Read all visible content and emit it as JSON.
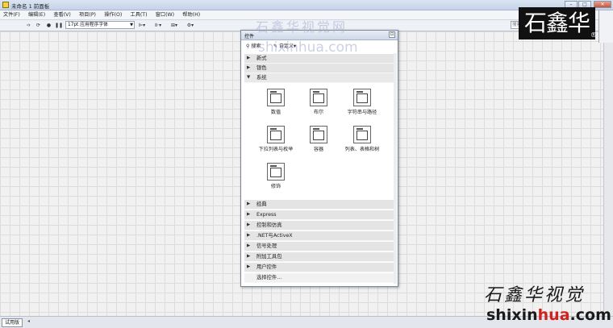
{
  "window": {
    "title": "未命名 1 前面板"
  },
  "menu": [
    "文件(F)",
    "编辑(E)",
    "查看(V)",
    "项目(P)",
    "操作(O)",
    "工具(T)",
    "窗口(W)",
    "帮助(H)"
  ],
  "toolbar": {
    "font": "17pt 应用程序字体",
    "search_placeholder": "搜索"
  },
  "palette": {
    "title": "控件",
    "search_label": "搜索",
    "customize_label": "自定义",
    "categories_top": [
      "新式",
      "银色",
      "系统"
    ],
    "items": [
      "数值",
      "布尔",
      "字符串与路径",
      "下拉列表与枚举",
      "容器",
      "列表、表格和树",
      "修饰"
    ],
    "categories_bottom": [
      "经典",
      "Express",
      "控制和仿真",
      ".NET与ActiveX",
      "信号处理",
      "附加工具包",
      "用户控件",
      "选择控件..."
    ]
  },
  "status": {
    "tab": "试用版"
  },
  "overlay": {
    "watermark_cn": "石鑫华视觉网",
    "watermark_url": "shixinhua.com",
    "logo": "石鑫华",
    "logo_mark": "®",
    "brush": "石鑫华视觉",
    "url_a": "shixin",
    "url_b": "hua",
    "url_c": ".com"
  }
}
